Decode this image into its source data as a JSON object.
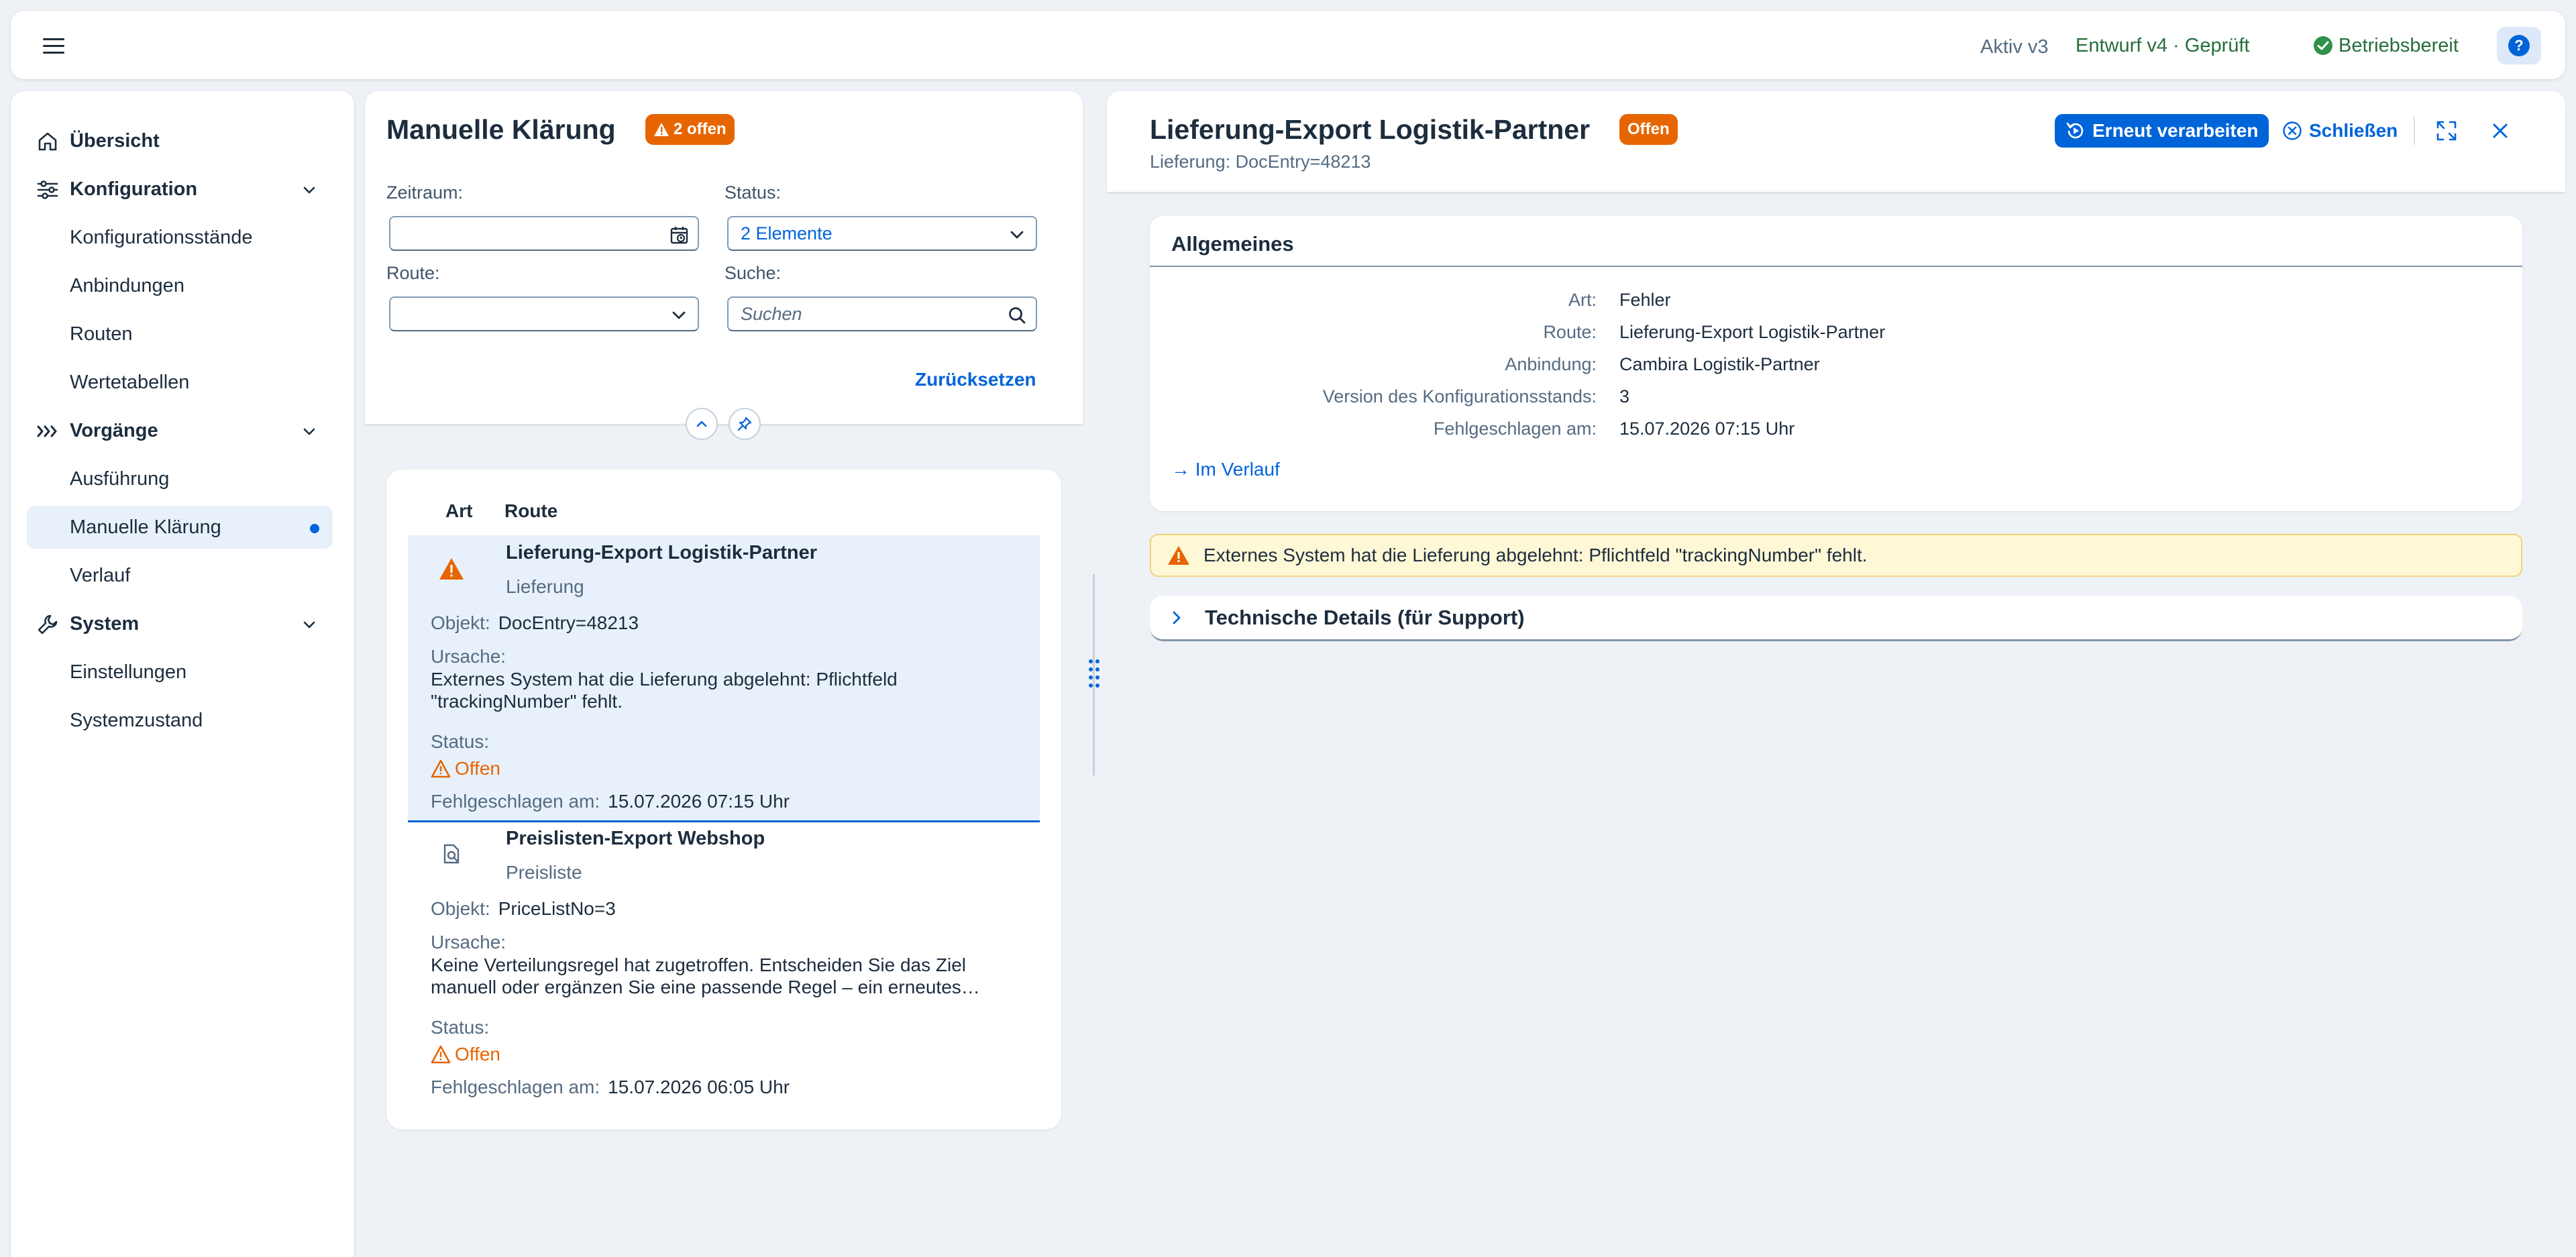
{
  "shell": {
    "active_version": "Aktiv v3",
    "draft_version": "Entwurf v4 · Geprüft",
    "status": "Betriebsbereit",
    "colors": {
      "success": "#256f3a",
      "accent": "#0064d9"
    },
    "icons": [
      "menu-icon",
      "check-circle-icon",
      "help-icon"
    ]
  },
  "sidebar": {
    "items": [
      {
        "label": "Übersicht",
        "icon": "home-icon"
      },
      {
        "label": "Konfiguration",
        "icon": "settings-sliders-icon"
      },
      {
        "label": "Konfigurationsstände"
      },
      {
        "label": "Anbindungen"
      },
      {
        "label": "Routen"
      },
      {
        "label": "Wertetabellen"
      },
      {
        "label": "Vorgänge",
        "icon": "process-icon"
      },
      {
        "label": "Ausführung"
      },
      {
        "label": "Manuelle Klärung",
        "selected": true
      },
      {
        "label": "Verlauf"
      },
      {
        "label": "System",
        "icon": "wrench-icon"
      },
      {
        "label": "Einstellungen"
      },
      {
        "label": "Systemzustand"
      }
    ]
  },
  "list": {
    "title": "Manuelle Klärung",
    "open_badge": "2 offen",
    "filters": {
      "zeitraum_label": "Zeitraum:",
      "status_label": "Status:",
      "status_value": "2 Elemente",
      "route_label": "Route:",
      "suche_label": "Suche:",
      "suche_placeholder": "Suchen"
    },
    "reset_label": "Zurücksetzen",
    "columns": {
      "art": "Art",
      "route": "Route"
    },
    "rows": [
      {
        "title": "Lieferung-Export Logistik-Partner",
        "subtitle": "Lieferung",
        "object_label": "Objekt:",
        "object_value": "DocEntry=48213",
        "cause_label": "Ursache:",
        "cause_text": "Externes System hat die Lieferung abgelehnt: Pflichtfeld \"trackingNumber\" fehlt.",
        "status_label": "Status:",
        "status_value": "Offen",
        "failed_label": "Fehlgeschlagen am:",
        "failed_value": "15.07.2026 07:15 Uhr",
        "icon": "warning-icon"
      },
      {
        "title": "Preislisten-Export Webshop",
        "subtitle": "Preisliste",
        "object_label": "Objekt:",
        "object_value": "PriceListNo=3",
        "cause_label": "Ursache:",
        "cause_text": "Keine Verteilungsregel hat zugetroffen. Entscheiden Sie das Ziel manuell oder ergänzen Sie eine passende Regel – ein erneutes…",
        "status_label": "Status:",
        "status_value": "Offen",
        "failed_label": "Fehlgeschlagen am:",
        "failed_value": "15.07.2026 06:05 Uhr",
        "icon": "document-search-icon"
      }
    ]
  },
  "detail": {
    "title": "Lieferung-Export Logistik-Partner",
    "badge": "Offen",
    "subtitle": "Lieferung: DocEntry=48213",
    "reprocess_label": "Erneut verarbeiten",
    "close_label": "Schließen",
    "section_title": "Allgemeines",
    "fields": [
      {
        "label": "Art:",
        "value": "Fehler"
      },
      {
        "label": "Route:",
        "value": "Lieferung-Export Logistik-Partner"
      },
      {
        "label": "Anbindung:",
        "value": "Cambira Logistik-Partner"
      },
      {
        "label": "Version des Konfigurationsstands:",
        "value": "3"
      },
      {
        "label": "Fehlgeschlagen am:",
        "value": "15.07.2026 07:15 Uhr"
      }
    ],
    "history_link": "→ Im Verlauf",
    "warning_message": "Externes System hat die Lieferung abgelehnt: Pflichtfeld \"trackingNumber\" fehlt.",
    "tech_details": "Technische Details (für Support)",
    "colors": {
      "warning": "#e76500",
      "warning_bg": "#fff8d6"
    }
  }
}
